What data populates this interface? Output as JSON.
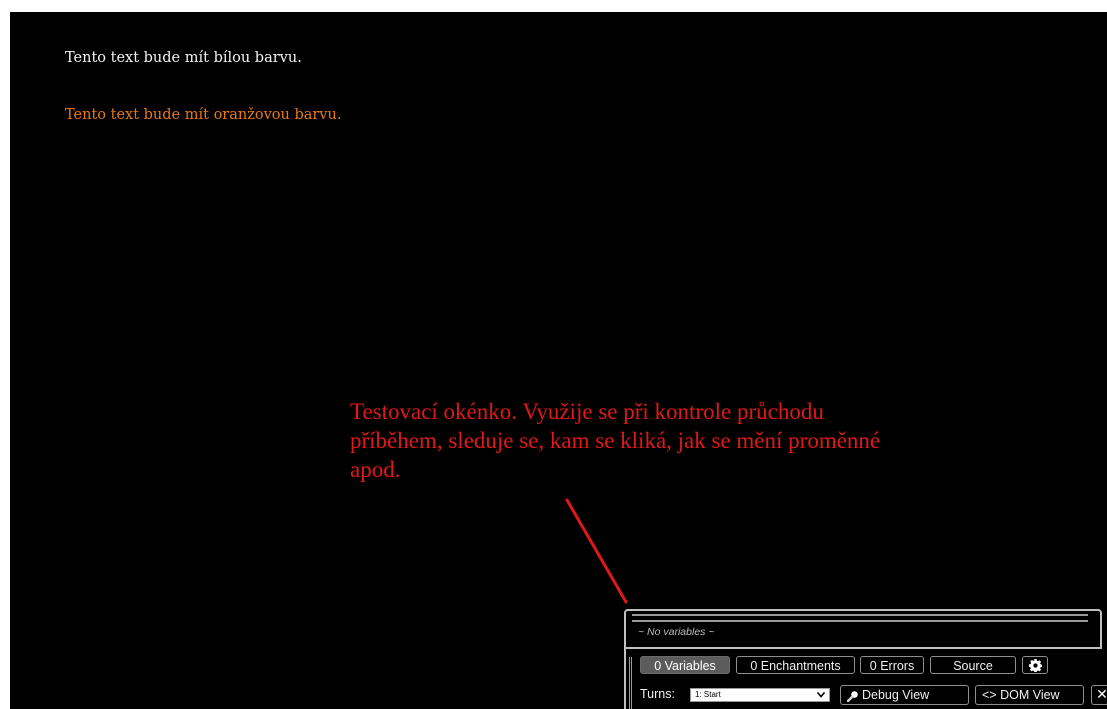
{
  "passage": {
    "line_white": "Tento text bude mít bílou barvu.",
    "line_orange": "Tento text bude mít oranžovou barvu."
  },
  "annotation": {
    "text": "Testovací okénko. Využije se při kontrole průchodu příběhem, sleduje se, kam se kliká, jak se mění proměnné apod."
  },
  "debug": {
    "watch_empty": "~ No variables ~",
    "tabs": [
      {
        "label": "0 Variables",
        "active": true
      },
      {
        "label": "0 Enchantments",
        "active": false
      },
      {
        "label": "0 Errors",
        "active": false
      },
      {
        "label": "Source",
        "active": false
      }
    ],
    "settings_icon": "gear-icon",
    "turns_label": "Turns:",
    "turns_selected": "1: Start",
    "debug_view_label": "Debug View",
    "debug_view_icon": "magnifier-icon",
    "dom_view_label": "<> DOM View",
    "close_label": "✕"
  },
  "colors": {
    "background": "#000000",
    "white_text": "#f2f2f2",
    "orange_text": "#e87a12",
    "annotation": "#e01818"
  }
}
